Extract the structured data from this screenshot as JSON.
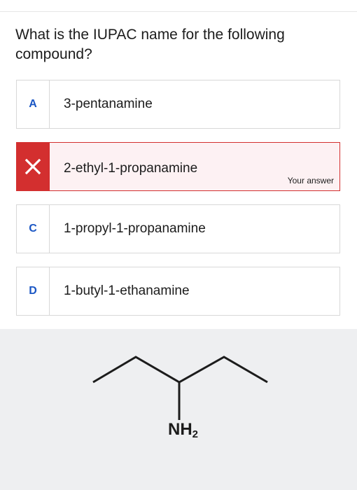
{
  "question": {
    "text": "What is the IUPAC name for the following compound?"
  },
  "options": [
    {
      "letter": "A",
      "text": "3-pentanamine"
    },
    {
      "letter": "",
      "text": "2-ethyl-1-propanamine",
      "status": "incorrect",
      "icon": "close-icon",
      "tag": "Your answer"
    },
    {
      "letter": "C",
      "text": "1-propyl-1-propanamine"
    },
    {
      "letter": "D",
      "text": "1-butyl-1-ethanamine"
    }
  ],
  "figure": {
    "amine_main": "NH",
    "amine_sub": "2"
  },
  "colors": {
    "accent": "#1a56c4",
    "error": "#d32f2f",
    "error_bg": "#fdf1f3",
    "figure_bg": "#eeeff1"
  }
}
